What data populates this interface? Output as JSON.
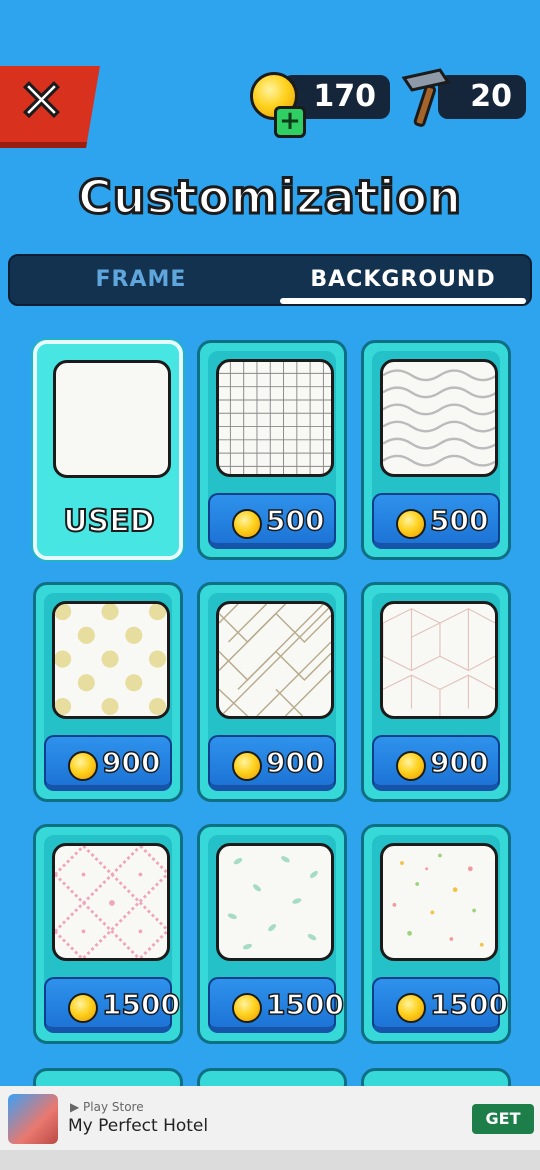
{
  "header": {
    "coins": "170",
    "hammers": "20",
    "close_icon": "close-icon",
    "add_icon": "plus-icon"
  },
  "title": "Customization",
  "tabs": [
    {
      "label": "FRAME",
      "active": false
    },
    {
      "label": "BACKGROUND",
      "active": true
    }
  ],
  "items": [
    {
      "pattern": "plain",
      "state": "used",
      "label": "USED"
    },
    {
      "pattern": "grid",
      "price": "500"
    },
    {
      "pattern": "waves",
      "price": "500"
    },
    {
      "pattern": "dots",
      "price": "900"
    },
    {
      "pattern": "lattice",
      "price": "900"
    },
    {
      "pattern": "cubes",
      "price": "900"
    },
    {
      "pattern": "pink-diamond",
      "price": "1500"
    },
    {
      "pattern": "leaves",
      "price": "1500"
    },
    {
      "pattern": "confetti",
      "price": "1500"
    }
  ],
  "ad": {
    "store": "Play Store",
    "title": "My Perfect Hotel",
    "cta": "GET"
  },
  "colors": {
    "background": "#2ea3ee",
    "card": "#37d9d8",
    "price_button": "#1d74d6",
    "close_button": "#d8321f"
  }
}
